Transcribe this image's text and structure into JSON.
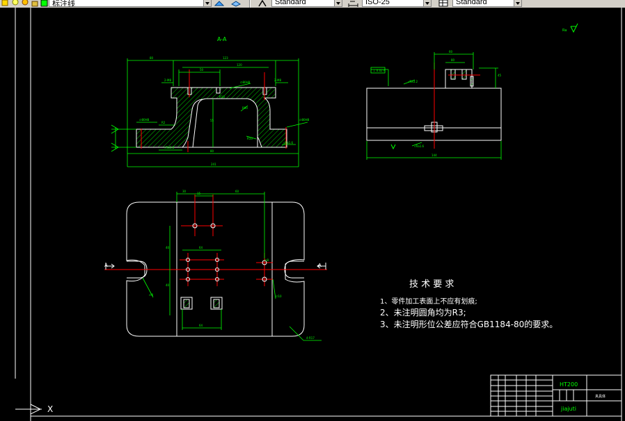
{
  "toolbar": {
    "layer_name": "标注线",
    "text_style": "Standard",
    "dim_style": "ISO-25",
    "table_style": "Standard"
  },
  "drawing": {
    "section_label": "A-A",
    "roughness_mark": "▽",
    "dimensions": {
      "top_overall": "241",
      "top_mid": "123",
      "top_inner": "120",
      "bottom_total": "241",
      "side_width": "144",
      "side_height_top": "60",
      "plan_top": "64",
      "plan_bottom": "64"
    },
    "section_marks": {
      "left": "A",
      "right": "A"
    },
    "note_r": "4-R17"
  },
  "tech_requirements": {
    "title": "技 术 要 求",
    "items": [
      "1、零件加工表面上不应有划痕;",
      "2、未注明圆角均为R3;",
      "3、未注明形位公差应符合GB1184-80的要求。"
    ]
  },
  "title_block": {
    "material": "HT200",
    "part_name": "夹具体",
    "company": "jiajuti"
  },
  "ucs": {
    "x_label": "X"
  },
  "colors": {
    "outline": "#ffffff",
    "dimension": "#00ff00",
    "centerline": "#ff0000",
    "hatch": "#00ff00",
    "ui_face": "#d4d0c8",
    "canvas": "#000000"
  }
}
